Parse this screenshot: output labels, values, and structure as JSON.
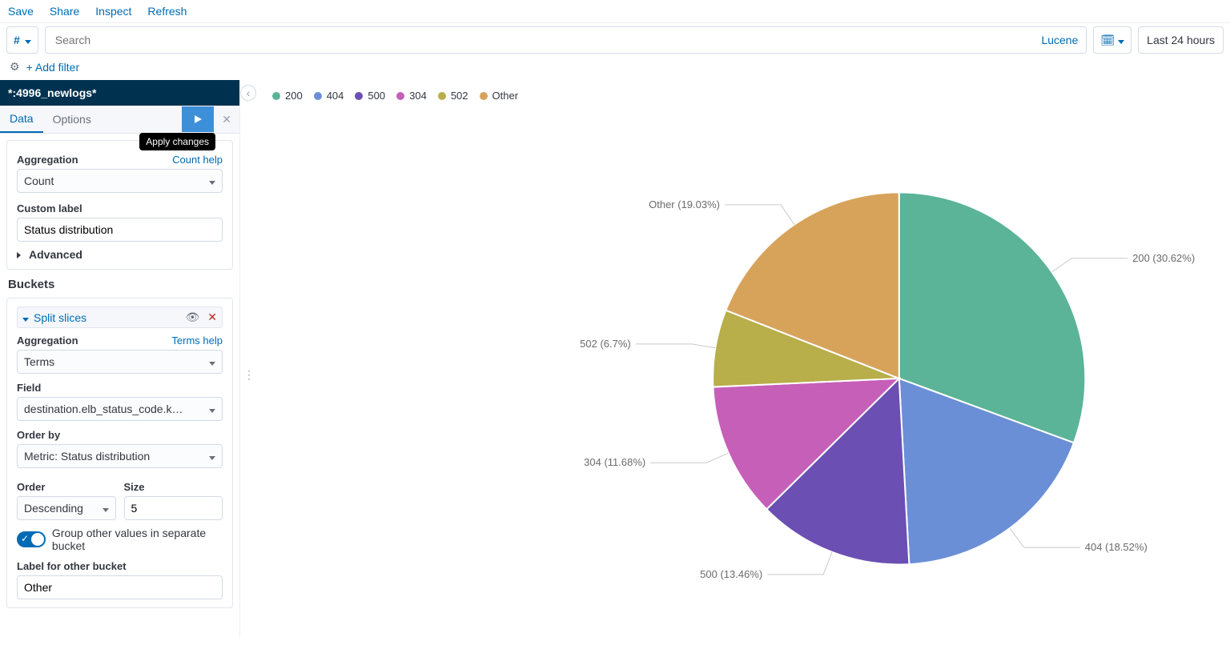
{
  "top_links": {
    "save": "Save",
    "share": "Share",
    "inspect": "Inspect",
    "refresh": "Refresh"
  },
  "query_bar": {
    "filter_prefix": "#",
    "search_placeholder": "Search",
    "language": "Lucene",
    "time_range": "Last 24 hours"
  },
  "filter_row": {
    "add_filter": "+ Add filter"
  },
  "sidebar": {
    "index_pattern": "*:4996_newlogs*",
    "tabs": {
      "data": "Data",
      "options": "Options"
    },
    "apply_tooltip": "Apply changes",
    "metrics": {
      "aggregation_label": "Aggregation",
      "aggregation_help": "Count help",
      "aggregation_value": "Count",
      "custom_label_label": "Custom label",
      "custom_label_value": "Status distribution",
      "advanced": "Advanced"
    },
    "buckets_title": "Buckets",
    "bucket": {
      "name": "Split slices",
      "aggregation_label": "Aggregation",
      "aggregation_help": "Terms help",
      "aggregation_value": "Terms",
      "field_label": "Field",
      "field_value": "destination.elb_status_code.k…",
      "orderby_label": "Order by",
      "orderby_value": "Metric: Status distribution",
      "order_label": "Order",
      "order_value": "Descending",
      "size_label": "Size",
      "size_value": "5",
      "group_other_label": "Group other values in separate bucket",
      "other_label_label": "Label for other bucket",
      "other_label_value": "Other"
    }
  },
  "chart_data": {
    "type": "pie",
    "title": "",
    "series": [
      {
        "name": "200",
        "value": 30.62,
        "color": "#5BB498"
      },
      {
        "name": "404",
        "value": 18.52,
        "color": "#6B8FD6"
      },
      {
        "name": "500",
        "value": 13.46,
        "color": "#6B4FB3"
      },
      {
        "name": "304",
        "value": 11.68,
        "color": "#C65FB8"
      },
      {
        "name": "502",
        "value": 6.7,
        "color": "#B8AE4A"
      },
      {
        "name": "Other",
        "value": 19.03,
        "color": "#D7A35B"
      }
    ],
    "labels": {
      "s200": "200 (30.62%)",
      "s404": "404 (18.52%)",
      "s500": "500 (13.46%)",
      "s304": "304 (11.68%)",
      "s502": "502 (6.7%)",
      "sOther": "Other (19.03%)"
    }
  }
}
